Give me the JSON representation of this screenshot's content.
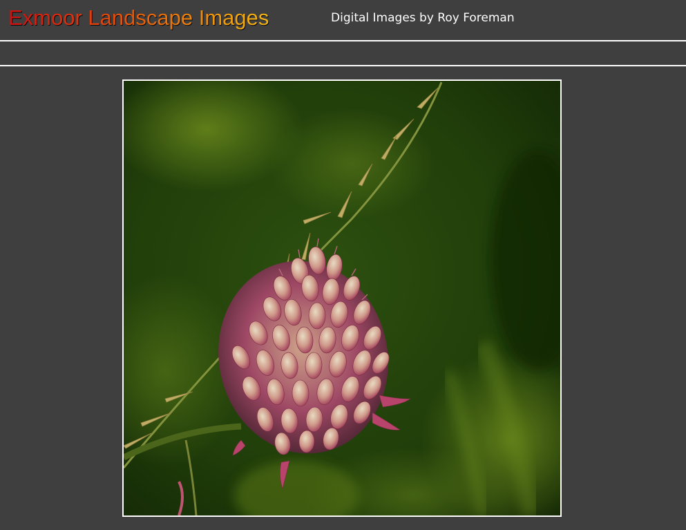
{
  "header": {
    "title": "Exmoor Landscape Images",
    "subtitle": "Digital Images by Roy Foreman"
  },
  "nav": {
    "items": []
  },
  "photo": {
    "subject": "allium-flower-head-photo",
    "colors": {
      "background_dark": "#1b3408",
      "background_light": "#6b8a1c",
      "flower_pink": "#b84870",
      "flower_cream": "#e8d4b0",
      "grass": "#c8b060"
    }
  },
  "theme": {
    "page_background": "#3f3f3f",
    "divider": "#ffffff",
    "subtitle_color": "#ffffff"
  }
}
